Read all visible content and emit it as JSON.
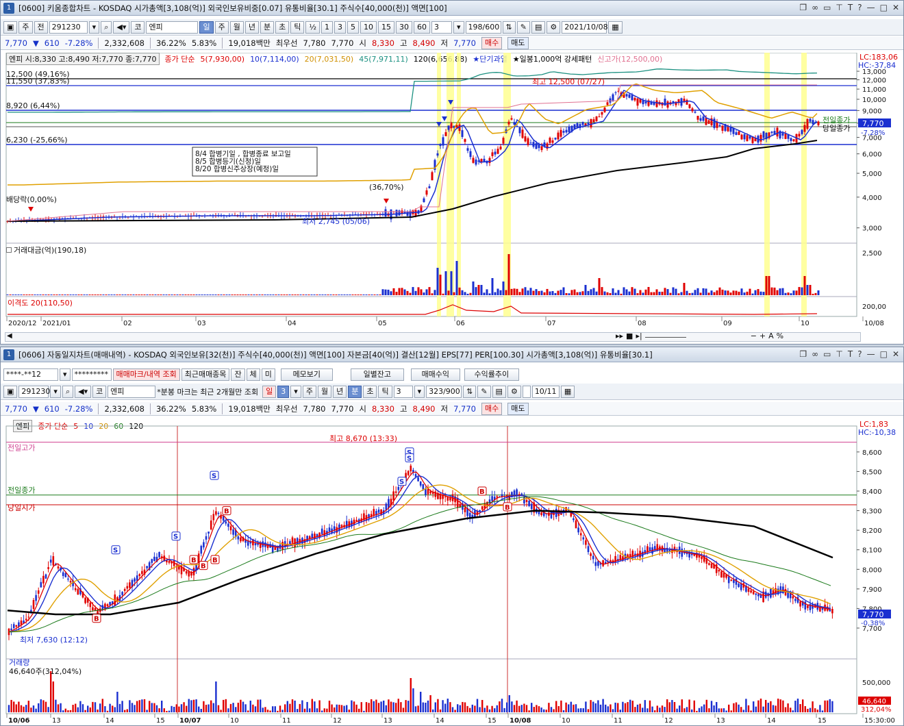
{
  "win1": {
    "num": "1",
    "title": "[0600] 키움종합차트 - KOSDAQ 시가총액[3,108(억)] 외국인보유비중[0.07] 유통비율[30.1] 주식수[40,000(천)] 액면[100]",
    "toolbar": {
      "period_label": "주",
      "prev_label": "전",
      "code": "291230",
      "market": "코",
      "name": "엔피",
      "periods": [
        "일",
        "주",
        "월",
        "년",
        "분",
        "초",
        "틱"
      ],
      "selected_period": "일",
      "half": "½",
      "intervals": [
        "1",
        "3",
        "5",
        "10",
        "15",
        "30",
        "60"
      ],
      "interval_value": "3",
      "count": "198/600",
      "date": "2021/10/08"
    },
    "quote": {
      "price": "7,770",
      "change": "610",
      "rate": "-7.28%",
      "volume": "2,332,608",
      "vol_rate": "36.22%",
      "turnover": "5.83%",
      "amount": "19,018백만",
      "best_label": "최우선",
      "best_ask": "7,780",
      "best_bid": "7,770",
      "open_label": "시",
      "open": "8,330",
      "high_label": "고",
      "high": "8,490",
      "low_label": "저",
      "low": "7,770",
      "buy": "매수",
      "sell": "매도"
    },
    "legend": {
      "ohlc": "엔피 시:8,330 고:8,490 저:7,770 종:7,770",
      "ma_title": "종가 단순",
      "ma5": "5(7,930,00)",
      "ma10": "10(7,114,00)",
      "ma20": "20(7,031,50)",
      "ma45": "45(7,971,11)",
      "ma120": "120(6,656,88)",
      "signal1": "★단기과열",
      "signal2": "★일봉1,000억 강세패턴",
      "signal3": "신고가(12,500,00)"
    },
    "lc": "LC:183,06",
    "hc": "HC:-37,84",
    "levels": [
      {
        "label": "12,500 (49,16%)",
        "value": 12500
      },
      {
        "label": "11,550 (37,83%)",
        "value": 11550
      },
      {
        "label": "8,920 (6,44%)",
        "value": 8920
      },
      {
        "label": "6,230 (-25,66%)",
        "value": 6230
      }
    ],
    "annotations": {
      "high": "최고 12,500 (07/27)",
      "low": "최저 2,745 (05/06)",
      "dividend": "배당락(0,00%)",
      "jump": "(36,70%)",
      "prev_close": "전일종가",
      "today_close": "당일종가",
      "price_tag": "7,770",
      "rate_tag": "-7,28%"
    },
    "notice": [
      "8/4 합병기일 , 합병종료 보고일",
      "8/5 합병등기(신청)일",
      "8/20 합병신주상장(예정)일"
    ],
    "y_ticks": [
      "13,000",
      "12,000",
      "11,000",
      "10,000",
      "9,000",
      "8,000",
      "7,000",
      "6,000",
      "5,000",
      "4,000",
      "3,000"
    ],
    "volume_label": "거래대금(억)(190,18)",
    "volume_tick": "2,500",
    "disparity_label": "이격도 20(110,50)",
    "disparity_tick": "200,00",
    "x_labels": [
      "2020/12",
      "2021/01",
      "02",
      "03",
      "04",
      "05",
      "06",
      "07",
      "08",
      "09",
      "10",
      "10/08"
    ]
  },
  "win2": {
    "num": "1",
    "title": "[0606] 자동일지차트(매매내역) - KOSDAQ 외국인보유[32(천)] 주식수[40,000(천)] 액면[100] 자본금[40(억)] 결산[12월] EPS[77] PER[100.30] 시가총액[3,108(억)] 유통비율[30.1]",
    "toolbar1": {
      "account": "****-**12",
      "password": "*********",
      "mark_btn": "매매마크/내역 조회",
      "recent_btn": "최근매매종목",
      "jan": "잔",
      "che": "체",
      "mi": "미",
      "memo": "메모보기",
      "daily": "일별잔고",
      "profit": "매매수익",
      "return": "수익률추이"
    },
    "toolbar2": {
      "code": "291230",
      "market": "코",
      "name": "엔피",
      "note": "*분봉 마크는 최근 2개월만 조회",
      "periods": [
        "일",
        "3",
        "주",
        "월",
        "년",
        "분",
        "초",
        "틱"
      ],
      "interval_value": "3",
      "count": "323/900",
      "date": "10/11"
    },
    "quote": {
      "price": "7,770",
      "change": "610",
      "rate": "-7.28%",
      "volume": "2,332,608",
      "vol_rate": "36.22%",
      "turnover": "5.83%",
      "amount": "19,018백만",
      "best_label": "최우선",
      "best_ask": "7,780",
      "best_bid": "7,770",
      "open_label": "시",
      "open": "8,330",
      "high_label": "고",
      "high": "8,490",
      "low_label": "저",
      "low": "7,770",
      "buy": "매수",
      "sell": "매도"
    },
    "legend": {
      "name": "엔피",
      "ma_title": "종가 단순",
      "ma5": "5",
      "ma10": "10",
      "ma20": "20",
      "ma60": "60",
      "ma120": "120"
    },
    "lc": "LC:1,83",
    "hc": "HC:-10,38",
    "annotations": {
      "high": "최고 8,670 (13:33)",
      "low": "최저 7,630 (12:12)",
      "prev_high": "전일고가",
      "prev_close": "전일종가",
      "today_open": "당일시가",
      "price_tag": "7,770",
      "rate_tag": "-0,38%"
    },
    "y_ticks": [
      "8,600",
      "8,500",
      "8,400",
      "8,300",
      "8,200",
      "8,100",
      "8,000",
      "7,900",
      "7,800",
      "7,700"
    ],
    "volume_label": "거래량",
    "volume_sub": "46,640주(312,04%)",
    "volume_tick": "500,000",
    "volume_tag": "46,640",
    "volume_tag2": "312,04%",
    "x_labels": [
      "10/06",
      "13",
      "14",
      "15",
      "10/07",
      "10",
      "11",
      "12",
      "13",
      "14",
      "15",
      "10/08",
      "10",
      "11",
      "12",
      "13",
      "14",
      "15",
      "15:30:00"
    ]
  },
  "colors": {
    "up": "#e00000",
    "down": "#1a2fd0",
    "ma5": "#e00000",
    "ma10": "#1a2fd0",
    "ma20": "#e0a000",
    "ma45": "#1a9080",
    "ma60": "#1a7a1a",
    "ma120": "#000000"
  }
}
